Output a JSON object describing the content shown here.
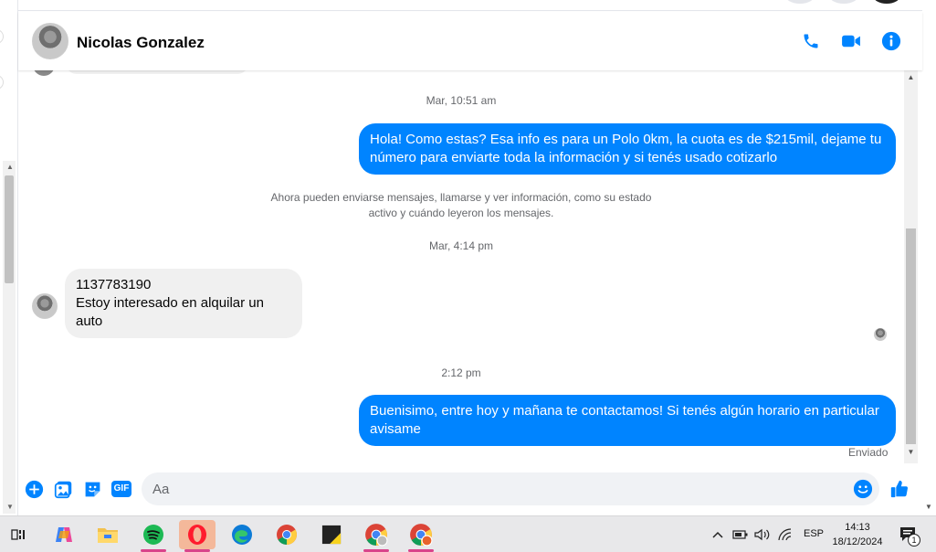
{
  "header": {
    "contact_name": "Nicolas Gonzalez"
  },
  "chat": {
    "timestamp_1": "Mar, 10:51 am",
    "outgoing_1": "Hola! Como estas? Esa info es para un Polo 0km, la cuota es de $215mil, dejame tu número para enviarte toda la información y si tenés usado cotizarlo",
    "system_notice": "Ahora pueden enviarse mensajes, llamarse y ver información, como su estado activo y cuándo leyeron los mensajes.",
    "timestamp_2": "Mar, 4:14 pm",
    "incoming_line_1": "1137783190",
    "incoming_line_2": "Estoy interesado en alquilar un auto",
    "timestamp_3": "2:12 pm",
    "outgoing_2": "Buenisimo, entre hoy y mañana te contactamos! Si tenés algún horario en particular avisame",
    "status": "Enviado"
  },
  "composer": {
    "placeholder": "Aa",
    "gif_label": "GIF"
  },
  "taskbar": {
    "language": "ESP",
    "time": "14:13",
    "date": "18/12/2024",
    "notification_count": "1"
  },
  "colors": {
    "messenger_blue": "#0084ff",
    "incoming_bubble": "#f0f0f0"
  }
}
